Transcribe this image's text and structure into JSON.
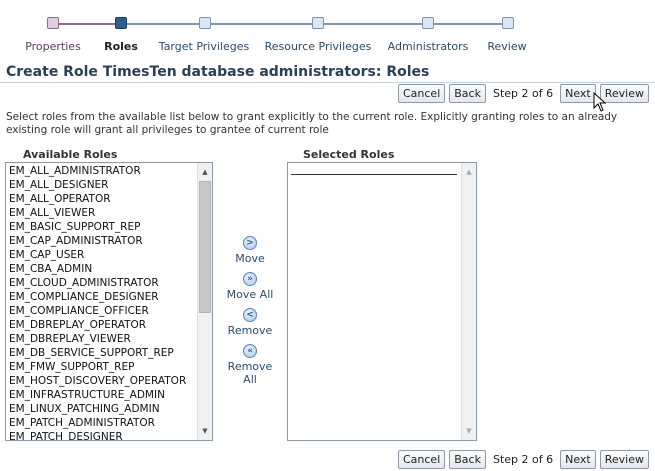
{
  "train": {
    "steps": [
      {
        "label": "Properties",
        "state": "visited"
      },
      {
        "label": "Roles",
        "state": "current"
      },
      {
        "label": "Target Privileges",
        "state": "unvisited"
      },
      {
        "label": "Resource Privileges",
        "state": "unvisited"
      },
      {
        "label": "Administrators",
        "state": "unvisited"
      },
      {
        "label": "Review",
        "state": "unvisited"
      }
    ]
  },
  "page": {
    "title": "Create Role TimesTen database administrators: Roles",
    "description": "Select roles from the available list below to grant explicitly to the current role. Explicitly granting roles to an already existing role will grant all privileges to grantee of current role"
  },
  "nav": {
    "cancel": "Cancel",
    "back": "Back",
    "step": "Step 2 of 6",
    "next": "Next",
    "review": "Review"
  },
  "available": {
    "label": "Available Roles",
    "items": [
      "EM_ALL_ADMINISTRATOR",
      "EM_ALL_DESIGNER",
      "EM_ALL_OPERATOR",
      "EM_ALL_VIEWER",
      "EM_BASIC_SUPPORT_REP",
      "EM_CAP_ADMINISTRATOR",
      "EM_CAP_USER",
      "EM_CBA_ADMIN",
      "EM_CLOUD_ADMINISTRATOR",
      "EM_COMPLIANCE_DESIGNER",
      "EM_COMPLIANCE_OFFICER",
      "EM_DBREPLAY_OPERATOR",
      "EM_DBREPLAY_VIEWER",
      "EM_DB_SERVICE_SUPPORT_REP",
      "EM_FMW_SUPPORT_REP",
      "EM_HOST_DISCOVERY_OPERATOR",
      "EM_INFRASTRUCTURE_ADMIN",
      "EM_LINUX_PATCHING_ADMIN",
      "EM_PATCH_ADMINISTRATOR",
      "EM_PATCH_DESIGNER"
    ]
  },
  "selected": {
    "label": "Selected Roles",
    "items": []
  },
  "shuttle": {
    "move": "Move",
    "move_all": "Move All",
    "remove": "Remove",
    "remove_all": "Remove All"
  },
  "colors": {
    "current_stop": "#2f5f86",
    "visited_stop": "#dfcde3",
    "title": "#2c3f5a"
  }
}
